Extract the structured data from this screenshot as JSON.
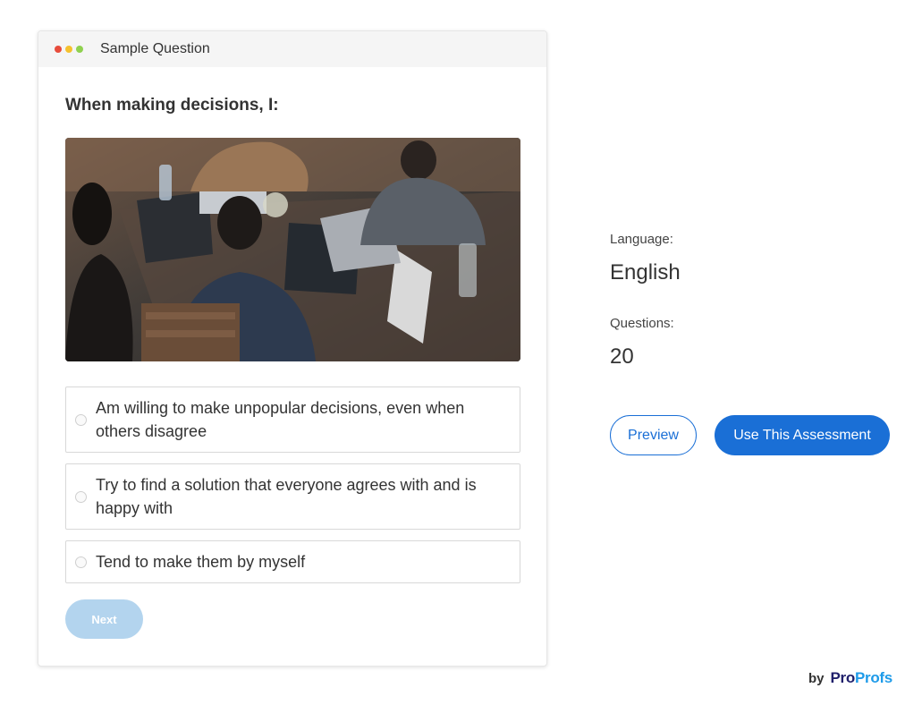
{
  "window": {
    "title": "Sample Question"
  },
  "question": {
    "text": "When making decisions, I:",
    "image_icon": "office-team-laptops-photo",
    "options": [
      {
        "label": "Am willing to make unpopular decisions, even when others disagree"
      },
      {
        "label": "Try to find a solution that everyone agrees with and is happy with"
      },
      {
        "label": "Tend to make them by myself"
      }
    ],
    "next_label": "Next"
  },
  "info": {
    "language_label": "Language:",
    "language_value": "English",
    "questions_label": "Questions:",
    "questions_value": "20"
  },
  "actions": {
    "preview_label": "Preview",
    "use_label": "Use This Assessment"
  },
  "footer": {
    "by": "by",
    "brand_part1": "Pro",
    "brand_part2": "Profs"
  },
  "colors": {
    "accent": "#1a6fd6",
    "next_disabled": "#b3d4ee",
    "brand_dark": "#1f1f6b",
    "brand_light": "#1e9be9"
  }
}
